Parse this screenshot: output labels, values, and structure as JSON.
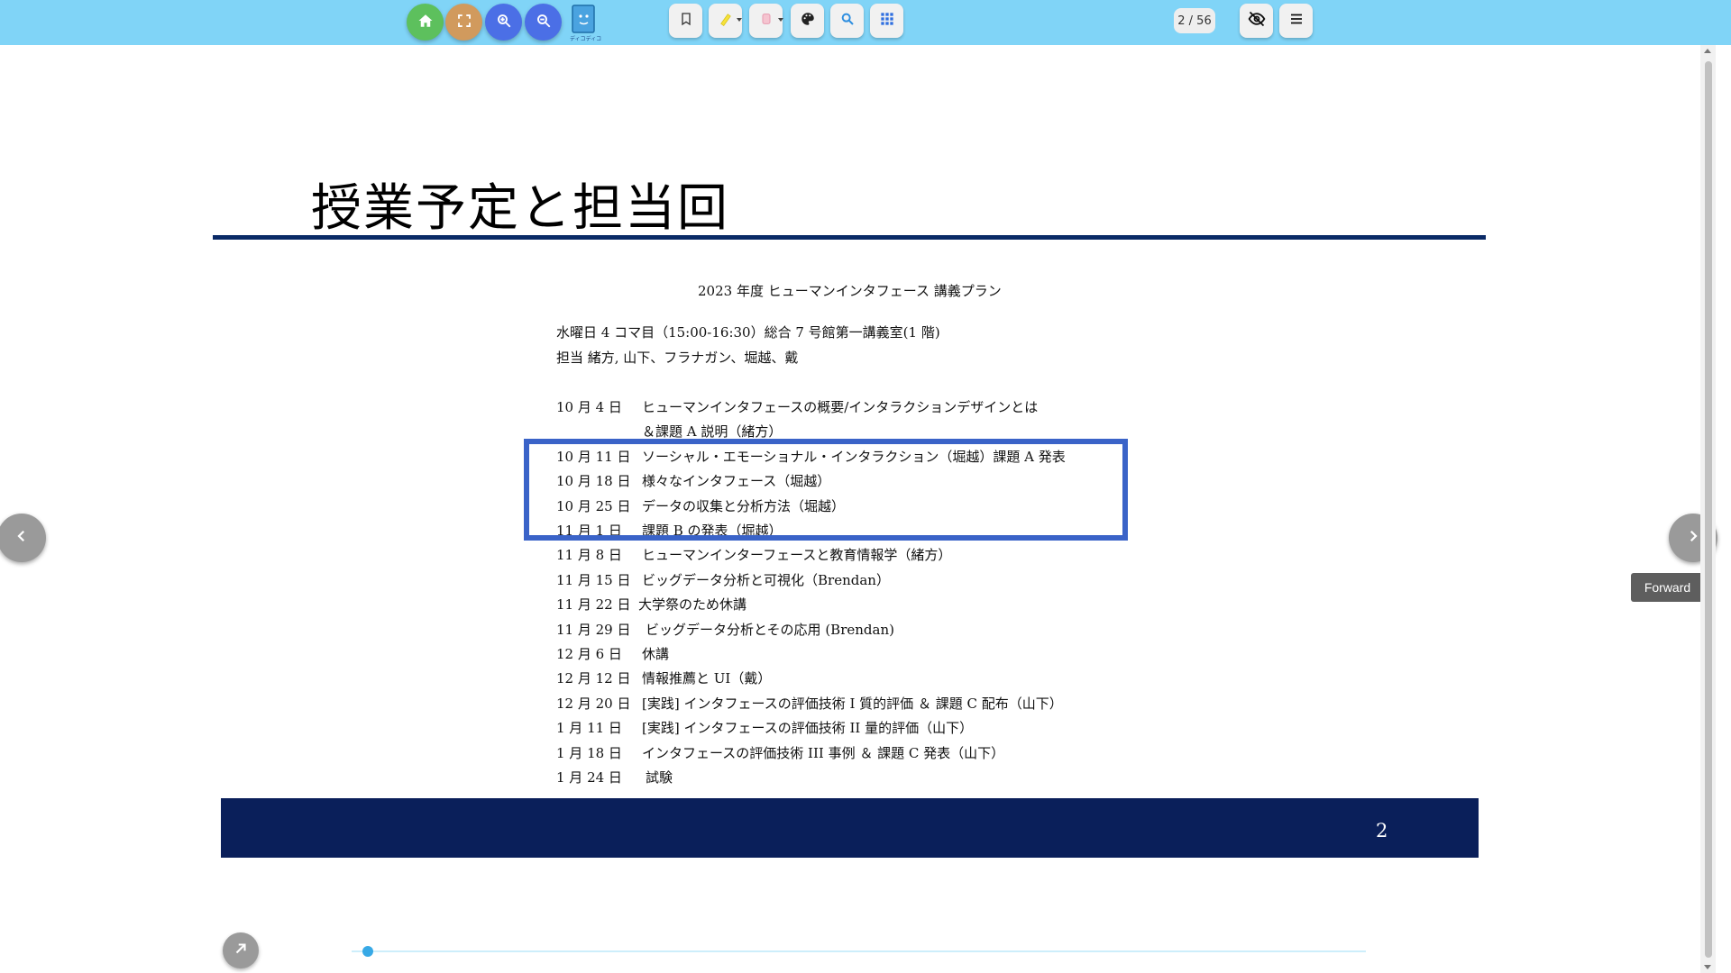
{
  "toolbar": {
    "home_color": "#5dc05d",
    "fullscreen_color": "#d19a5d",
    "zoom_in_color": "#4b6fe6",
    "zoom_out_color": "#4b6fe6",
    "logo_text": "ディコディコ",
    "page_indicator": "2 / 56",
    "icons": [
      "home-icon",
      "fullscreen-icon",
      "zoom-in-icon",
      "zoom-out-icon",
      "app-logo-icon",
      "bookmark-icon",
      "highlighter-icon",
      "eraser-icon",
      "palette-icon",
      "search-icon",
      "grid-icon",
      "hide-icon",
      "menu-icon"
    ]
  },
  "slide": {
    "title": "授業予定と担当回",
    "doc_heading": "2023 年度 ヒューマンインタフェース 講義プラン",
    "info_line1": "水曜日 4 コマ目（15:00-16:30）総合 7 号館第一講義室(1 階)",
    "info_line2": "担当 緒方, 山下、フラナガン、堀越、戴",
    "schedule": [
      {
        "date": "10 月 4 日",
        "topic": "ヒューマンインタフェースの概要/インタラクションデザインとは"
      },
      {
        "date": "",
        "topic": "＆課題 A 説明（緒方）"
      },
      {
        "date": "10 月 11 日",
        "topic": "ソーシャル・エモーショナル・インタラクション（堀越）課題 A 発表"
      },
      {
        "date": "10 月 18 日",
        "topic": "様々なインタフェース（堀越）"
      },
      {
        "date": "10 月 25 日",
        "topic": "データの収集と分析方法（堀越）"
      },
      {
        "date": "11 月 1 日",
        "topic": "課題 B の発表（堀越）"
      },
      {
        "date": "11 月 8 日",
        "topic": "ヒューマンインターフェースと教育情報学（緒方）"
      },
      {
        "date": "11 月 15 日",
        "topic": "ビッグデータ分析と可視化（Brendan）"
      },
      {
        "date": "11 月 22 日",
        "topic": "大学祭のため休講"
      },
      {
        "date": "11 月 29 日",
        "topic": "ビッグデータ分析とその応用 (Brendan)"
      },
      {
        "date": "12 月 6 日",
        "topic": "休講"
      },
      {
        "date": "12 月 12 日",
        "topic": "情報推薦と UI（戴）"
      },
      {
        "date": "12 月 20 日",
        "topic": "[実践] インタフェースの評価技術 I 質的評価 ＆ 課題 C 配布（山下）"
      },
      {
        "date": "1 月 11 日",
        "topic": "[実践] インタフェースの評価技術 II 量的評価（山下）"
      },
      {
        "date": "1 月 18 日",
        "topic": "インタフェースの評価技術 III 事例 ＆ 課題 C 発表（山下）"
      },
      {
        "date": "1 月 24 日",
        "topic": "試験"
      }
    ],
    "highlight_color": "#3a63c8",
    "footer_color": "#0a1f5a",
    "page_number": "2"
  },
  "navigation": {
    "forward_tooltip": "Forward"
  },
  "progress": {
    "current_page": 2,
    "total_pages": 56
  }
}
